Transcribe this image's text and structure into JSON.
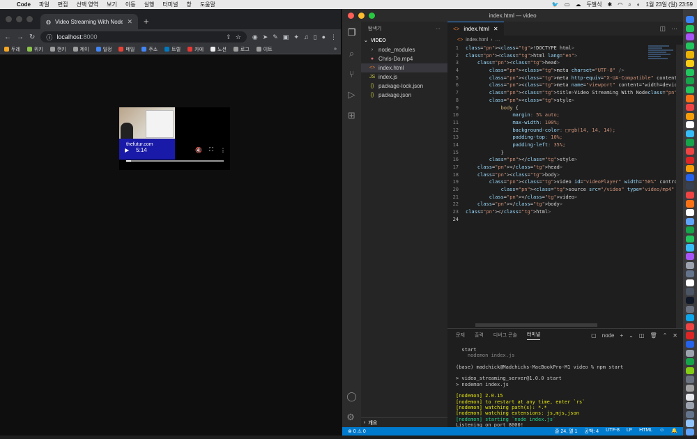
{
  "menubar": {
    "app": "Code",
    "items": [
      "파일",
      "편집",
      "선택 영역",
      "보기",
      "이동",
      "실행",
      "터미널",
      "창",
      "도움말"
    ],
    "keyboard": "두벌식",
    "datetime": "1월 23일 (일)  23:59"
  },
  "chrome": {
    "tab_title": "Video Streaming With Node",
    "url_host": "localhost",
    "url_port": ":8000",
    "bookmarks": [
      {
        "label": "두레",
        "color": "#f5a623"
      },
      {
        "label": "위키",
        "color": "#8bc34a"
      },
      {
        "label": "깬키",
        "color": "#9e9e9e"
      },
      {
        "label": "제이",
        "color": "#9e9e9e"
      },
      {
        "label": "일정",
        "color": "#4285f4"
      },
      {
        "label": "메일",
        "color": "#ea4335"
      },
      {
        "label": "주소",
        "color": "#4285f4"
      },
      {
        "label": "트렐",
        "color": "#0079bf"
      },
      {
        "label": "카에",
        "color": "#e53935"
      },
      {
        "label": "노션",
        "color": "#eeeeee"
      },
      {
        "label": "로그",
        "color": "#9e9e9e"
      },
      {
        "label": "이트",
        "color": "#9e9e9e"
      }
    ],
    "video": {
      "time": "5:14",
      "banner": "thefutur.com",
      "progress": 0.05
    }
  },
  "vscode": {
    "title": "index.html — video",
    "explorer_label": "탐색기",
    "section": "VIDEO",
    "files": [
      {
        "name": "node_modules",
        "icon": "›",
        "color": "#cccccc"
      },
      {
        "name": "Chris-Do.mp4",
        "icon": "●",
        "color": "#e06c75"
      },
      {
        "name": "index.html",
        "icon": "<>",
        "color": "#e37933"
      },
      {
        "name": "index.js",
        "icon": "JS",
        "color": "#cbcb41"
      },
      {
        "name": "package-lock.json",
        "icon": "{}",
        "color": "#cbcb41"
      },
      {
        "name": "package.json",
        "icon": "{}",
        "color": "#cbcb41"
      }
    ],
    "outline": "개요",
    "tab": "index.html",
    "breadcrumb": [
      "index.html",
      "…"
    ],
    "code": [
      "<!DOCTYPE html>",
      "<html lang=\"en\">",
      "    <head>",
      "        <meta charset=\"UTF-8\" />",
      "        <meta http-equiv=\"X-UA-Compatible\" content=\"IE=edg",
      "        <meta name=\"viewport\" content=\"width=device-width,",
      "        <title>Video Streaming With Node</title>",
      "        <style>",
      "            body {",
      "                margin: 5% auto;",
      "                max-width: 100%;",
      "                background-color: □rgb(14, 14, 14);",
      "                padding-top: 10%;",
      "                padding-left: 35%;",
      "            }",
      "        </style>",
      "    </head>",
      "    <body>",
      "        <video id=\"videoPlayer\" width=\"50%\" controls muted",
      "            <source src=\"/video\" type=\"video/mp4\" />",
      "        </video>",
      "    </body>",
      "</html>",
      ""
    ],
    "panel_tabs": [
      "문제",
      "출력",
      "디버그 콘솔",
      "터미널"
    ],
    "terminal_shell": "node",
    "terminal": [
      {
        "text": "  start",
        "cls": ""
      },
      {
        "text": "    nodemon index.js",
        "cls": "dim"
      },
      {
        "text": "",
        "cls": ""
      },
      {
        "text": "(base) madchick@Madchicks-MacBookPro-M1 video % npm start",
        "cls": ""
      },
      {
        "text": "",
        "cls": ""
      },
      {
        "text": "> video_streaming_server@1.0.0 start",
        "cls": ""
      },
      {
        "text": "> nodemon index.js",
        "cls": ""
      },
      {
        "text": "",
        "cls": ""
      },
      {
        "text": "[nodemon] 2.0.15",
        "cls": "yellow"
      },
      {
        "text": "[nodemon] to restart at any time, enter `rs`",
        "cls": "yellow"
      },
      {
        "text": "[nodemon] watching path(s): *.*",
        "cls": "yellow"
      },
      {
        "text": "[nodemon] watching extensions: js,mjs,json",
        "cls": "yellow"
      },
      {
        "text": "[nodemon] starting `node index.js`",
        "cls": "green"
      },
      {
        "text": "Listening on port 8000!",
        "cls": ""
      },
      {
        "text": "▯",
        "cls": ""
      }
    ],
    "status": {
      "errors": "⊗ 0 ⚠ 0",
      "position": "줄 24, 열 1",
      "spaces": "공백: 4",
      "encoding": "UTF-8",
      "eol": "LF",
      "lang": "HTML"
    }
  },
  "dock_colors": [
    "#3b82f6",
    "#22c55e",
    "#a855f7",
    "#22c55e",
    "#eab308",
    "#facc15",
    "#22c55e",
    "#16a34a",
    "#22c55e",
    "#f97316",
    "#ef4444",
    "#f59e0b",
    "#ffffff",
    "#38bdf8",
    "#16a34a",
    "#ef4444",
    "#dc2626",
    "#f59e0b",
    "#2563eb",
    "#374151",
    "#ef4444",
    "#f97316",
    "#ffffff",
    "#60a5fa",
    "#16a34a",
    "#22c55e",
    "#38bdf8",
    "#a855f7",
    "#9ca3af",
    "#64748b",
    "#ffffff",
    "#4b5563",
    "#111827",
    "#6b7280",
    "#0ea5e9",
    "#ef4444",
    "#dc2626",
    "#2563eb",
    "#9ca3af",
    "#16a34a",
    "#84cc16",
    "#6b7280",
    "#a3a3a3",
    "#e5e7eb",
    "#9ca3af",
    "#64748b",
    "#93c5fd",
    "#60a5fa"
  ]
}
